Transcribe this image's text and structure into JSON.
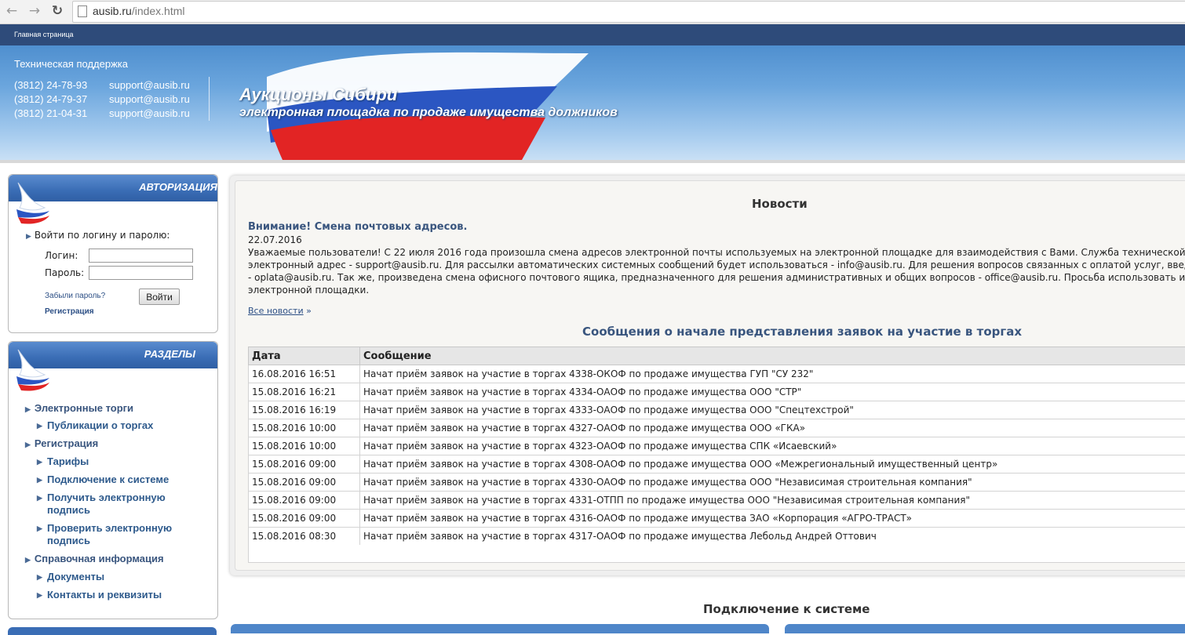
{
  "browser": {
    "url_host": "ausib.ru",
    "url_path": "/index.html"
  },
  "topnav": {
    "home": "Главная страница"
  },
  "support": {
    "title": "Техническая поддержка",
    "rows": [
      {
        "phone": "(3812) 24-78-93",
        "email": "support@ausib.ru"
      },
      {
        "phone": "(3812) 24-79-37",
        "email": "support@ausib.ru"
      },
      {
        "phone": "(3812) 21-04-31",
        "email": "support@ausib.ru"
      }
    ]
  },
  "site": {
    "title": "Аукционы Сибири",
    "subtitle": "электронная площадка по продаже имущества должников"
  },
  "auth": {
    "header": "АВТОРИЗАЦИЯ",
    "intro": "Войти по логину и паролю:",
    "login_label": "Логин:",
    "password_label": "Пароль:",
    "forgot": "Забыли пароль?",
    "register": "Регистрация",
    "submit": "Войти"
  },
  "sections": {
    "header": "РАЗДЕЛЫ",
    "items": [
      {
        "label": "Электронные торги"
      },
      {
        "label": "Публикации о торгах"
      },
      {
        "label": "Регистрация"
      },
      {
        "label": "Тарифы"
      },
      {
        "label": "Подключение к системе"
      },
      {
        "label": "Получить электронную подпись"
      },
      {
        "label": "Проверить электронную подпись"
      },
      {
        "label": "Справочная информация"
      },
      {
        "label": "Документы"
      },
      {
        "label": "Контакты и реквизиты"
      }
    ]
  },
  "news": {
    "heading": "Новости",
    "title": "Внимание! Смена почтовых адресов.",
    "date": "22.07.2016",
    "body": [
      "Уважаемые пользователи! С 22 июля 2016 года произошла смена адресов электронной почты используемых на электронной площадке для взаимодействия с Вами.   Служба технической подде",
      "электронный адрес - support@ausib.ru. Для рассылки автоматических системных сообщений будет использоваться - info@ausib.ru. Для решения вопросов связанных с оплатой услуг, введен нов",
      "- oplata@ausib.ru. Так же, произведена смена офисного почтового ящика, предназначенного для решения административных и общих вопросов - office@ausib.ru.   Просьба использовать их для",
      "электронной площадки."
    ],
    "all_link": "Все новости",
    "all_suffix": "»"
  },
  "messages": {
    "heading": "Сообщения о начале представления заявок на участие в торгах",
    "columns": [
      "Дата",
      "Сообщение"
    ],
    "rows": [
      {
        "date": "16.08.2016 16:51",
        "text": "Начат приём заявок на участие в торгах 4338-ОКОФ по продаже имущества ГУП \"СУ 232\""
      },
      {
        "date": "15.08.2016 16:21",
        "text": "Начат приём заявок на участие в торгах 4334-ОАОФ по продаже имущества ООО \"СТР\""
      },
      {
        "date": "15.08.2016 16:19",
        "text": "Начат приём заявок на участие в торгах 4333-ОАОФ по продаже имущества ООО \"Спецтехстрой\""
      },
      {
        "date": "15.08.2016 10:00",
        "text": "Начат приём заявок на участие в торгах 4327-ОАОФ по продаже имущества ООО «ГКА»"
      },
      {
        "date": "15.08.2016 10:00",
        "text": "Начат приём заявок на участие в торгах 4323-ОАОФ по продаже имущества СПК «Исаевский»"
      },
      {
        "date": "15.08.2016 09:00",
        "text": "Начат приём заявок на участие в торгах 4308-ОАОФ по продаже имущества ООО «Межрегиональный имущественный центр»"
      },
      {
        "date": "15.08.2016 09:00",
        "text": "Начат приём заявок на участие в торгах 4330-ОАОФ по продаже имущества ООО \"Независимая строительная компания\""
      },
      {
        "date": "15.08.2016 09:00",
        "text": "Начат приём заявок на участие в торгах 4331-ОТПП по продаже имущества ООО \"Независимая строительная компания\""
      },
      {
        "date": "15.08.2016 09:00",
        "text": "Начат приём заявок на участие в торгах 4316-ОАОФ по продаже имущества ЗАО «Корпорация «АГРО-ТРАСТ»"
      },
      {
        "date": "15.08.2016 08:30",
        "text": "Начат приём заявок на участие в торгах 4317-ОАОФ по продаже имущества Лебольд Андрей Оттович"
      }
    ]
  },
  "connect": {
    "heading": "Подключение к системе"
  }
}
